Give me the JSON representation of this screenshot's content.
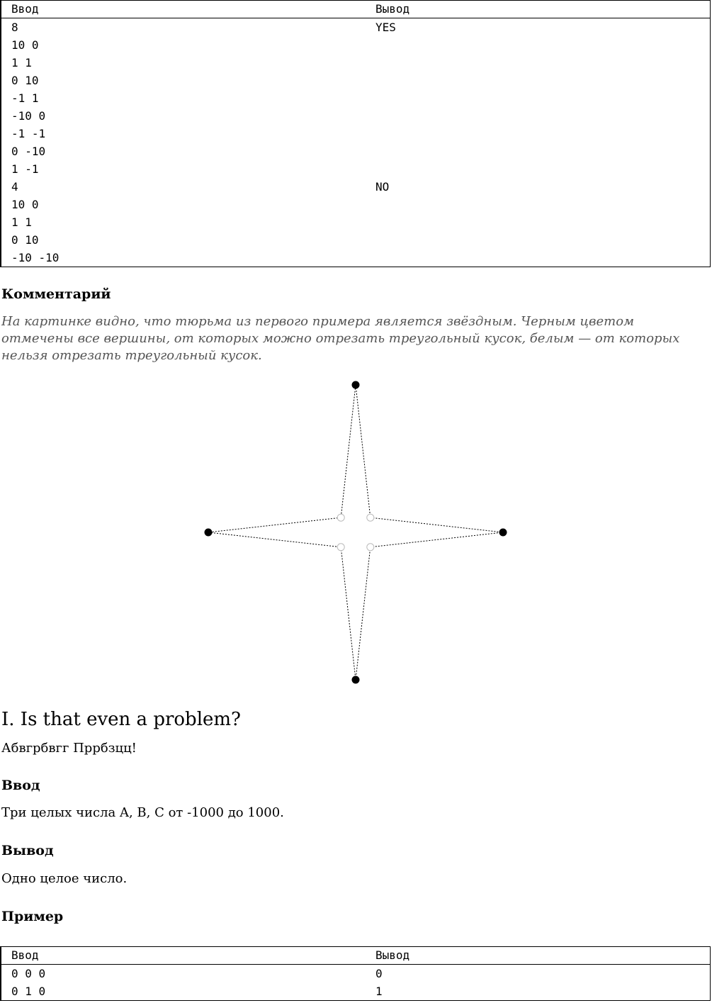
{
  "example1": {
    "header_in": "Ввод",
    "header_out": "Вывод",
    "tests": [
      {
        "input": [
          "8",
          "10 0",
          "1 1",
          "0 10",
          "-1 1",
          "-10 0",
          "-1 -1",
          "0 -10",
          "1 -1"
        ],
        "output": [
          "YES"
        ]
      },
      {
        "input": [
          "4",
          "10 0",
          "1 1",
          "0 10",
          "-10 -10"
        ],
        "output": [
          "NO"
        ]
      }
    ]
  },
  "comment": {
    "title": "Комментарий",
    "text": "На картинке видно, что тюрьма из первого примера является звёздным. Черным цветом отмечены все вершины, от которых можно отрезать треугольный кусок, белым — от которых нельзя отрезать треугольный кусок."
  },
  "figure": {
    "points": [
      {
        "x": 0,
        "y": 10,
        "fill": "black"
      },
      {
        "x": 1,
        "y": 1,
        "fill": "white"
      },
      {
        "x": 10,
        "y": 0,
        "fill": "black"
      },
      {
        "x": 1,
        "y": -1,
        "fill": "white"
      },
      {
        "x": 0,
        "y": -10,
        "fill": "black"
      },
      {
        "x": -1,
        "y": -1,
        "fill": "white"
      },
      {
        "x": -10,
        "y": 0,
        "fill": "black"
      },
      {
        "x": -1,
        "y": 1,
        "fill": "white"
      }
    ]
  },
  "problem": {
    "title": "I. Is that even a problem?",
    "statement": "Абвгрбвгг Пррбзцц!",
    "input_title": "Ввод",
    "input_text": "Три целых числа A, B, C от -1000 до 1000.",
    "output_title": "Вывод",
    "output_text": "Одно целое число.",
    "example_title": "Пример"
  },
  "example2": {
    "header_in": "Ввод",
    "header_out": "Вывод",
    "rows": [
      {
        "input": "0 0 0",
        "output": "0"
      },
      {
        "input": "0 1 0",
        "output": "1"
      }
    ]
  }
}
